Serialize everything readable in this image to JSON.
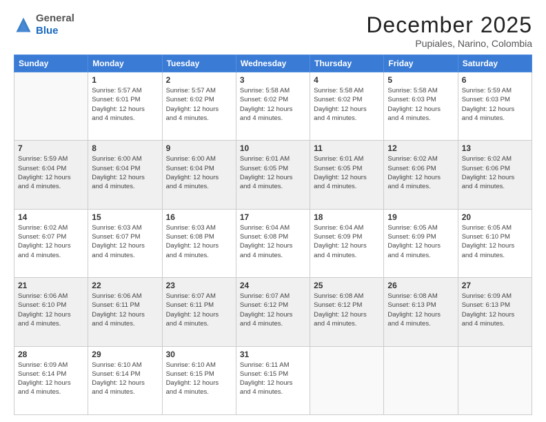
{
  "header": {
    "logo_general": "General",
    "logo_blue": "Blue",
    "month": "December 2025",
    "location": "Pupiales, Narino, Colombia"
  },
  "days_of_week": [
    "Sunday",
    "Monday",
    "Tuesday",
    "Wednesday",
    "Thursday",
    "Friday",
    "Saturday"
  ],
  "weeks": [
    [
      {
        "day": "",
        "info": ""
      },
      {
        "day": "1",
        "info": "Sunrise: 5:57 AM\nSunset: 6:01 PM\nDaylight: 12 hours\nand 4 minutes."
      },
      {
        "day": "2",
        "info": "Sunrise: 5:57 AM\nSunset: 6:02 PM\nDaylight: 12 hours\nand 4 minutes."
      },
      {
        "day": "3",
        "info": "Sunrise: 5:58 AM\nSunset: 6:02 PM\nDaylight: 12 hours\nand 4 minutes."
      },
      {
        "day": "4",
        "info": "Sunrise: 5:58 AM\nSunset: 6:02 PM\nDaylight: 12 hours\nand 4 minutes."
      },
      {
        "day": "5",
        "info": "Sunrise: 5:58 AM\nSunset: 6:03 PM\nDaylight: 12 hours\nand 4 minutes."
      },
      {
        "day": "6",
        "info": "Sunrise: 5:59 AM\nSunset: 6:03 PM\nDaylight: 12 hours\nand 4 minutes."
      }
    ],
    [
      {
        "day": "7",
        "info": "Sunrise: 5:59 AM\nSunset: 6:04 PM\nDaylight: 12 hours\nand 4 minutes."
      },
      {
        "day": "8",
        "info": "Sunrise: 6:00 AM\nSunset: 6:04 PM\nDaylight: 12 hours\nand 4 minutes."
      },
      {
        "day": "9",
        "info": "Sunrise: 6:00 AM\nSunset: 6:04 PM\nDaylight: 12 hours\nand 4 minutes."
      },
      {
        "day": "10",
        "info": "Sunrise: 6:01 AM\nSunset: 6:05 PM\nDaylight: 12 hours\nand 4 minutes."
      },
      {
        "day": "11",
        "info": "Sunrise: 6:01 AM\nSunset: 6:05 PM\nDaylight: 12 hours\nand 4 minutes."
      },
      {
        "day": "12",
        "info": "Sunrise: 6:02 AM\nSunset: 6:06 PM\nDaylight: 12 hours\nand 4 minutes."
      },
      {
        "day": "13",
        "info": "Sunrise: 6:02 AM\nSunset: 6:06 PM\nDaylight: 12 hours\nand 4 minutes."
      }
    ],
    [
      {
        "day": "14",
        "info": "Sunrise: 6:02 AM\nSunset: 6:07 PM\nDaylight: 12 hours\nand 4 minutes."
      },
      {
        "day": "15",
        "info": "Sunrise: 6:03 AM\nSunset: 6:07 PM\nDaylight: 12 hours\nand 4 minutes."
      },
      {
        "day": "16",
        "info": "Sunrise: 6:03 AM\nSunset: 6:08 PM\nDaylight: 12 hours\nand 4 minutes."
      },
      {
        "day": "17",
        "info": "Sunrise: 6:04 AM\nSunset: 6:08 PM\nDaylight: 12 hours\nand 4 minutes."
      },
      {
        "day": "18",
        "info": "Sunrise: 6:04 AM\nSunset: 6:09 PM\nDaylight: 12 hours\nand 4 minutes."
      },
      {
        "day": "19",
        "info": "Sunrise: 6:05 AM\nSunset: 6:09 PM\nDaylight: 12 hours\nand 4 minutes."
      },
      {
        "day": "20",
        "info": "Sunrise: 6:05 AM\nSunset: 6:10 PM\nDaylight: 12 hours\nand 4 minutes."
      }
    ],
    [
      {
        "day": "21",
        "info": "Sunrise: 6:06 AM\nSunset: 6:10 PM\nDaylight: 12 hours\nand 4 minutes."
      },
      {
        "day": "22",
        "info": "Sunrise: 6:06 AM\nSunset: 6:11 PM\nDaylight: 12 hours\nand 4 minutes."
      },
      {
        "day": "23",
        "info": "Sunrise: 6:07 AM\nSunset: 6:11 PM\nDaylight: 12 hours\nand 4 minutes."
      },
      {
        "day": "24",
        "info": "Sunrise: 6:07 AM\nSunset: 6:12 PM\nDaylight: 12 hours\nand 4 minutes."
      },
      {
        "day": "25",
        "info": "Sunrise: 6:08 AM\nSunset: 6:12 PM\nDaylight: 12 hours\nand 4 minutes."
      },
      {
        "day": "26",
        "info": "Sunrise: 6:08 AM\nSunset: 6:13 PM\nDaylight: 12 hours\nand 4 minutes."
      },
      {
        "day": "27",
        "info": "Sunrise: 6:09 AM\nSunset: 6:13 PM\nDaylight: 12 hours\nand 4 minutes."
      }
    ],
    [
      {
        "day": "28",
        "info": "Sunrise: 6:09 AM\nSunset: 6:14 PM\nDaylight: 12 hours\nand 4 minutes."
      },
      {
        "day": "29",
        "info": "Sunrise: 6:10 AM\nSunset: 6:14 PM\nDaylight: 12 hours\nand 4 minutes."
      },
      {
        "day": "30",
        "info": "Sunrise: 6:10 AM\nSunset: 6:15 PM\nDaylight: 12 hours\nand 4 minutes."
      },
      {
        "day": "31",
        "info": "Sunrise: 6:11 AM\nSunset: 6:15 PM\nDaylight: 12 hours\nand 4 minutes."
      },
      {
        "day": "",
        "info": ""
      },
      {
        "day": "",
        "info": ""
      },
      {
        "day": "",
        "info": ""
      }
    ]
  ]
}
